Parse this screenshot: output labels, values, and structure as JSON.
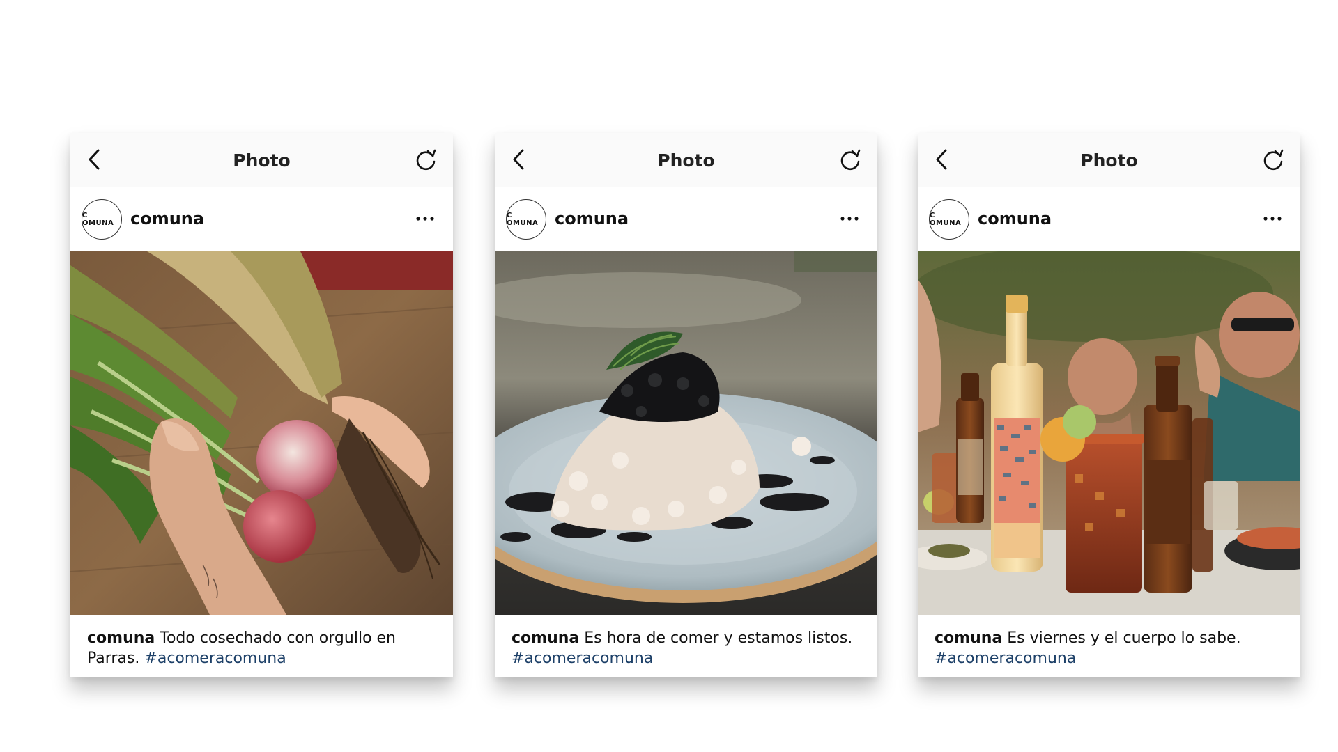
{
  "posts": [
    {
      "topbar_title": "Photo",
      "avatar_text": "C OMUNA",
      "username": "comuna",
      "caption_user": "comuna",
      "caption_text": "Todo cosechado con orgullo en Parras.",
      "hashtag": "#acomeracomuna"
    },
    {
      "topbar_title": "Photo",
      "avatar_text": "C OMUNA",
      "username": "comuna",
      "caption_user": "comuna",
      "caption_text": "Es hora de comer y estamos listos.",
      "hashtag": "#acomeracomuna"
    },
    {
      "topbar_title": "Photo",
      "avatar_text": "C OMUNA",
      "username": "comuna",
      "caption_user": "comuna",
      "caption_text": "Es viernes y el cuerpo lo sabe.",
      "hashtag": "#acomeracomuna"
    }
  ],
  "icons": {
    "back": "chevron-left-icon",
    "refresh": "refresh-icon",
    "more": "more-horizontal-icon"
  },
  "colors": {
    "hashtag": "#1d4068",
    "topbar_bg": "#fafafa"
  }
}
